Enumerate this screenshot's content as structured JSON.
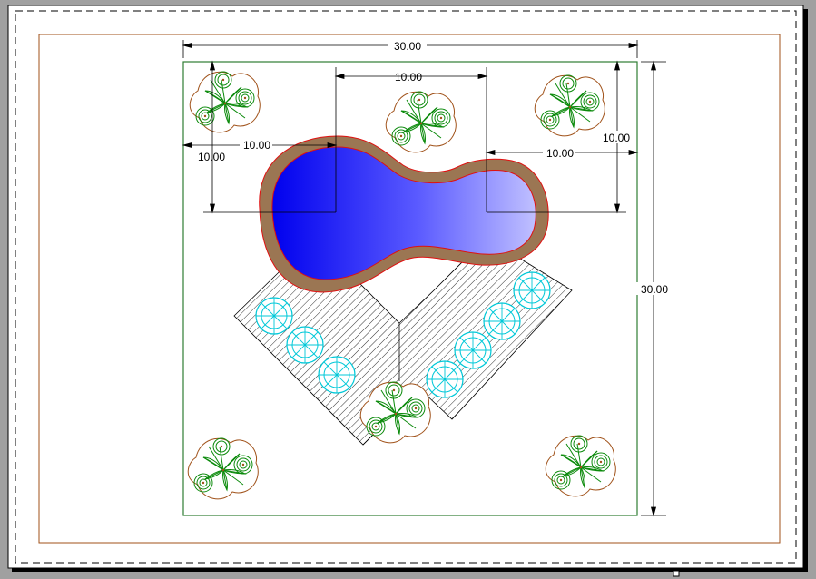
{
  "drawing": {
    "dimensions": {
      "overall_width": "30.00",
      "overall_height": "30.00",
      "pool_center_spacing": "10.00",
      "left_center_from_edge": "10.00",
      "left_center_from_top": "10.00",
      "right_center_from_edge": "10.00",
      "right_center_from_top": "10.00"
    },
    "colors": {
      "paper": "#ffffff",
      "background": "#a0a0a0",
      "print_margin": "#8b2a1a",
      "site_boundary": "#2e7d32",
      "pool_coping": "#9b7653",
      "pool_edge": "#e01010",
      "water_deep": "#0000ee",
      "water_shallow": "#b8b8ff",
      "deck_hatch": "#000000",
      "lounger": "#00c8d8",
      "plant_outline": "#a0521a",
      "plant_leaves": "#0b8a0b"
    },
    "icons": [
      "umbrella-icon",
      "planter-icon"
    ]
  }
}
